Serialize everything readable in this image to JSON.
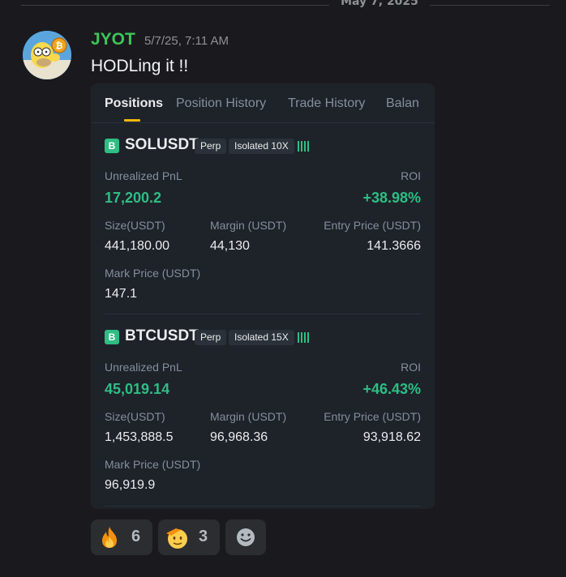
{
  "divider": {
    "date": "May 7, 2025"
  },
  "message": {
    "author": "JYOT",
    "timestamp": "5/7/25, 7:11 AM",
    "text": "HODLing  it !!",
    "author_color": "#3ec45a"
  },
  "card": {
    "tabs": [
      {
        "label": "Positions",
        "active": true
      },
      {
        "label": "Position History",
        "active": false
      },
      {
        "label": "Trade History",
        "active": false
      },
      {
        "label": "Balan",
        "active": false
      }
    ],
    "positions": [
      {
        "badge": "B",
        "symbol": "SOLUSDT",
        "type_tag": "Perp",
        "margin_tag": "Isolated 10X",
        "pnl_label": "Unrealized PnL",
        "pnl": "17,200.2",
        "roi_label": "ROI",
        "roi": "+38.98%",
        "size_label": "Size(USDT)",
        "size": "441,180.00",
        "margin_label": "Margin (USDT)",
        "margin": "44,130",
        "entry_label": "Entry Price (USDT)",
        "entry": "141.3666",
        "mark_label": "Mark Price (USDT)",
        "mark": "147.1"
      },
      {
        "badge": "B",
        "symbol": "BTCUSDT",
        "type_tag": "Perp",
        "margin_tag": "Isolated 15X",
        "pnl_label": "Unrealized PnL",
        "pnl": "45,019.14",
        "roi_label": "ROI",
        "roi": "+46.43%",
        "size_label": "Size(USDT)",
        "size": "1,453,888.5",
        "margin_label": "Margin (USDT)",
        "margin": "96,968.36",
        "entry_label": "Entry Price (USDT)",
        "entry": "93,918.62",
        "mark_label": "Mark Price (USDT)",
        "mark": "96,919.9"
      }
    ],
    "accent_color": "#f0b90b",
    "positive_color": "#2ebd85"
  },
  "reactions": [
    {
      "icon": "fire-emoji",
      "count": "6"
    },
    {
      "icon": "saluting-face-emoji",
      "count": "3"
    },
    {
      "icon": "add-reaction-icon",
      "count": ""
    }
  ]
}
